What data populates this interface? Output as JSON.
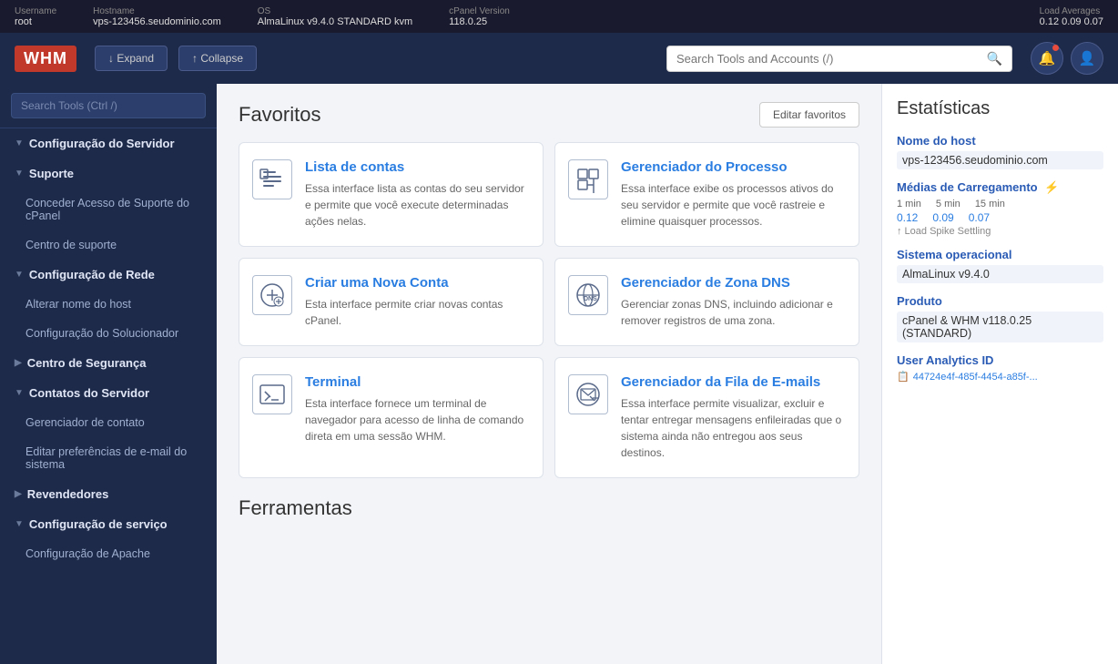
{
  "topbar": {
    "username_label": "Username",
    "username_value": "root",
    "hostname_label": "Hostname",
    "hostname_value": "vps-123456.seudominio.com",
    "os_label": "OS",
    "os_value": "AlmaLinux v9.4.0 STANDARD kvm",
    "cpanel_label": "cPanel Version",
    "cpanel_value": "118.0.25",
    "load_label": "Load Averages",
    "load_value": "0.12  0.09  0.07"
  },
  "header": {
    "logo": "WHM",
    "expand_label": "↓ Expand",
    "collapse_label": "↑ Collapse",
    "search_placeholder": "Search Tools and Accounts (/)"
  },
  "sidebar": {
    "search_placeholder": "Search Tools (Ctrl /)",
    "items": [
      {
        "label": "Configuração do Servidor",
        "type": "parent",
        "expanded": true
      },
      {
        "label": "Suporte",
        "type": "parent",
        "expanded": true
      },
      {
        "label": "Conceder Acesso de Suporte do cPanel",
        "type": "child"
      },
      {
        "label": "Centro de suporte",
        "type": "child"
      },
      {
        "label": "Configuração de Rede",
        "type": "parent",
        "expanded": true
      },
      {
        "label": "Alterar nome do host",
        "type": "child"
      },
      {
        "label": "Configuração do Solucionador",
        "type": "child"
      },
      {
        "label": "Centro de Segurança",
        "type": "parent",
        "expanded": false
      },
      {
        "label": "Contatos do Servidor",
        "type": "parent",
        "expanded": true
      },
      {
        "label": "Gerenciador de contato",
        "type": "child"
      },
      {
        "label": "Editar preferências de e-mail do sistema",
        "type": "child"
      },
      {
        "label": "Revendedores",
        "type": "parent",
        "expanded": false
      },
      {
        "label": "Configuração de serviço",
        "type": "parent",
        "expanded": true
      },
      {
        "label": "Configuração de Apache",
        "type": "child"
      }
    ]
  },
  "main": {
    "favoritos_title": "Favoritos",
    "edit_btn": "Editar favoritos",
    "ferramentas_title": "Ferramentas",
    "cards": [
      {
        "id": "lista-contas",
        "title": "Lista de contas",
        "desc": "Essa interface lista as contas do seu servidor e permite que você execute determinadas ações nelas.",
        "icon_type": "list"
      },
      {
        "id": "gerenciador-processo",
        "title": "Gerenciador do Processo",
        "desc": "Essa interface exibe os processos ativos do seu servidor e permite que você rastreie e elimine quaisquer processos.",
        "icon_type": "process"
      },
      {
        "id": "criar-conta",
        "title": "Criar uma Nova Conta",
        "desc": "Esta interface permite criar novas contas cPanel.",
        "icon_type": "add"
      },
      {
        "id": "zona-dns",
        "title": "Gerenciador de Zona DNS",
        "desc": "Gerenciar zonas DNS, incluindo adicionar e remover registros de uma zona.",
        "icon_type": "dns"
      },
      {
        "id": "terminal",
        "title": "Terminal",
        "desc": "Esta interface fornece um terminal de navegador para acesso de linha de comando direta em uma sessão WHM.",
        "icon_type": "terminal"
      },
      {
        "id": "fila-emails",
        "title": "Gerenciador da Fila de E-mails",
        "desc": "Essa interface permite visualizar, excluir e tentar entregar mensagens enfileiradas que o sistema ainda não entregou aos seus destinos.",
        "icon_type": "email"
      }
    ]
  },
  "stats": {
    "title": "Estatísticas",
    "hostname_label": "Nome do host",
    "hostname_value": "vps-123456.seudominio.com",
    "load_label": "Médias de Carregamento",
    "load_1min_label": "1 min",
    "load_5min_label": "5 min",
    "load_15min_label": "15 min",
    "load_1min_value": "0.12",
    "load_5min_value": "0.09",
    "load_15min_value": "0.07",
    "load_note": "↑ Load Spike Settling",
    "os_label": "Sistema operacional",
    "os_value": "AlmaLinux v9.4.0",
    "product_label": "Produto",
    "product_value": "cPanel & WHM v118.0.25 (STANDARD)",
    "analytics_label": "User Analytics ID",
    "analytics_value": "44724e4f-485f-4454-a85f-..."
  }
}
